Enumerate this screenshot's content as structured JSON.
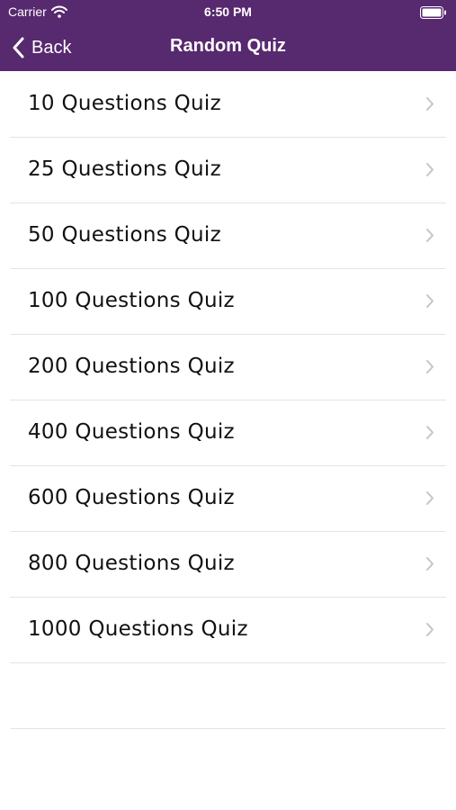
{
  "status_bar": {
    "carrier": "Carrier",
    "time": "6:50 PM",
    "icons": [
      "wifi-icon",
      "battery-icon"
    ]
  },
  "nav": {
    "back_label": "Back",
    "title": "Random Quiz"
  },
  "colors": {
    "nav_background": "#57296f",
    "nav_text": "#ffffff",
    "row_text": "#111111",
    "separator": "#e4e4e4",
    "chevron": "#c4c4c9"
  },
  "quiz_list": {
    "items": [
      {
        "label": "10 Questions Quiz"
      },
      {
        "label": "25 Questions Quiz"
      },
      {
        "label": "50 Questions Quiz"
      },
      {
        "label": "100 Questions Quiz"
      },
      {
        "label": "200 Questions Quiz"
      },
      {
        "label": "400 Questions Quiz"
      },
      {
        "label": "600 Questions Quiz"
      },
      {
        "label": "800 Questions Quiz"
      },
      {
        "label": "1000 Questions Quiz"
      }
    ]
  }
}
